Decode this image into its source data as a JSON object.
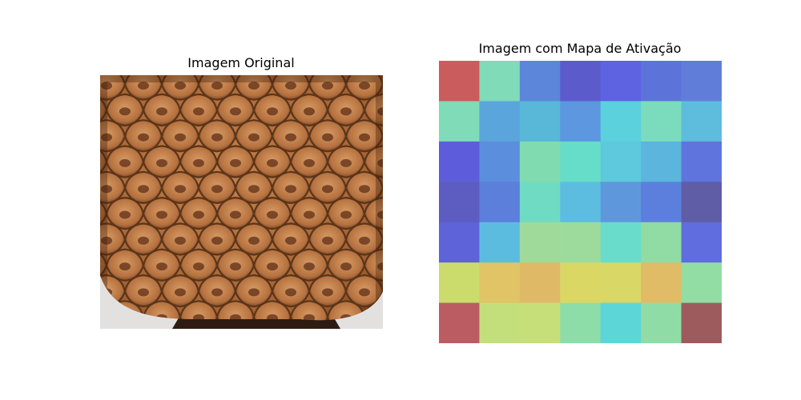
{
  "figure": {
    "left_title": "Imagem Original",
    "right_title": "Imagem com Mapa de Ativação"
  },
  "photo": {
    "subject": "pine-cone-close-up",
    "colors": {
      "background": "#e3e1e0",
      "scale_base": "#b5713f",
      "scale_light": "#d79a63",
      "scale_dark": "#6b3a1e",
      "edge": "#5a3519",
      "bottom_shadow": "#2e1c12"
    }
  },
  "chart_data": {
    "type": "heatmap",
    "title": "Imagem com Mapa de Ativação",
    "rows": 7,
    "cols": 7,
    "cell_colors": [
      [
        "#cb5c5e",
        "#7fdbb8",
        "#5c86da",
        "#5c5bcc",
        "#5d63e1",
        "#5c74da",
        "#607ed9"
      ],
      [
        "#7fdbb8",
        "#5aa6dc",
        "#59b7d8",
        "#5c97df",
        "#5bd1dd",
        "#7adcbc",
        "#5ebcdd"
      ],
      [
        "#5d5ddc",
        "#5b8fdd",
        "#81dbb0",
        "#66ddc9",
        "#5ec8dd",
        "#5bb5dc",
        "#5f74dc"
      ],
      [
        "#5c5cc1",
        "#5b7fdb",
        "#6fdbc2",
        "#5cbde0",
        "#5f97dc",
        "#5c7fde",
        "#5f5da5"
      ],
      [
        "#5e63d9",
        "#5cbce0",
        "#a0da9a",
        "#9ddb9d",
        "#69dccc",
        "#91dba5",
        "#5f6ddf"
      ],
      [
        "#cbdc6c",
        "#e0c465",
        "#e0b967",
        "#dad765",
        "#d9d765",
        "#e0bc66",
        "#92dda4"
      ],
      [
        "#bb5c62",
        "#c3df7c",
        "#c7df79",
        "#8cdda8",
        "#5dd6d8",
        "#8fdca6",
        "#9d5b5e"
      ]
    ]
  }
}
